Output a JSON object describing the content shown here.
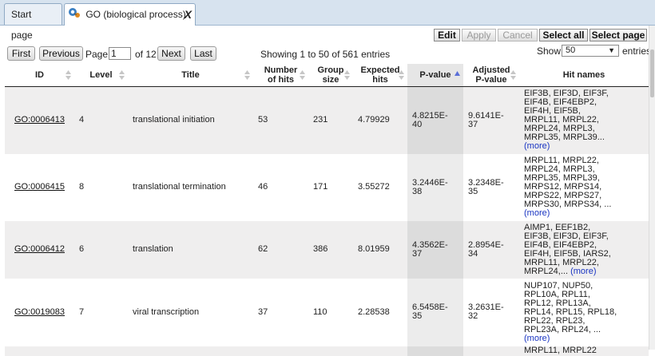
{
  "tabs": [
    {
      "label": "Start page"
    },
    {
      "label": "GO (biological process)",
      "close": "X"
    }
  ],
  "toolbar": {
    "edit": "Edit",
    "apply": "Apply",
    "cancel": "Cancel",
    "select_all": "Select all",
    "select_page": "Select page"
  },
  "pager": {
    "first": "First",
    "previous": "Previous",
    "page_label": "Page",
    "page_value": "1",
    "of_label": "of 12",
    "next": "Next",
    "last": "Last",
    "showing": "Showing 1 to 50 of 561 entries",
    "show_label": "Show",
    "show_value": "50",
    "entries_label": "entries"
  },
  "columns": {
    "id": "ID",
    "level": "Level",
    "title": "Title",
    "hits": "Number\nof hits",
    "group": "Group\nsize",
    "expected": "Expected\nhits",
    "pvalue": "P-value",
    "adj": "Adjusted\nP-value",
    "names": "Hit names"
  },
  "rows": [
    {
      "id": "GO:0006413",
      "level": "4",
      "title": "translational initiation",
      "hits": "53",
      "group": "231",
      "expected": "4.79929",
      "pvalue": "4.8215E-\n40",
      "adj": "9.6141E-\n37",
      "names": "EIF3B, EIF3D, EIF3F,\nEIF4B, EIF4EBP2,\nEIF4H, EIF5B,\nMRPL11, MRPL22,\nMRPL24, MRPL3,\nMRPL35, MRPL39...",
      "more": "(more)"
    },
    {
      "id": "GO:0006415",
      "level": "8",
      "title": "translational termination",
      "hits": "46",
      "group": "171",
      "expected": "3.55272",
      "pvalue": "3.2446E-\n38",
      "adj": "3.2348E-\n35",
      "names": "MRPL11, MRPL22,\nMRPL24, MRPL3,\nMRPL35, MRPL39,\nMRPS12, MRPS14,\nMRPS22, MRPS27,\nMRPS30, MRPS34, ...",
      "more": "(more)"
    },
    {
      "id": "GO:0006412",
      "level": "6",
      "title": "translation",
      "hits": "62",
      "group": "386",
      "expected": "8.01959",
      "pvalue": "4.3562E-\n37",
      "adj": "2.8954E-\n34",
      "names": "AIMP1, EEF1B2,\nEIF3B, EIF3D, EIF3F,\nEIF4B, EIF4EBP2,\nEIF4H, EIF5B, IARS2,\nMRPL11, MRPL22,\nMRPL24,...",
      "more": "(more)"
    },
    {
      "id": "GO:0019083",
      "level": "7",
      "title": "viral transcription",
      "hits": "37",
      "group": "110",
      "expected": "2.28538",
      "pvalue": "6.5458E-\n35",
      "adj": "3.2631E-\n32",
      "names": "NUP107, NUP50,\nRPL10A, RPL11,\nRPL12, RPL13A,\nRPL14, RPL15, RPL18,\nRPL22, RPL23,\nRPL23A, RPL24, ...",
      "more": "(more)"
    },
    {
      "id": "",
      "level": "",
      "title": "",
      "hits": "",
      "group": "",
      "expected": "",
      "pvalue": "",
      "adj": "",
      "names": "MRPL11, MRPL22",
      "more": ""
    }
  ],
  "icons": {
    "tab_icon": "go-network-icon",
    "sort": "sort-arrows-icon",
    "sort_asc": "sort-ascending-icon",
    "dropdown": "dropdown-caret-icon"
  }
}
